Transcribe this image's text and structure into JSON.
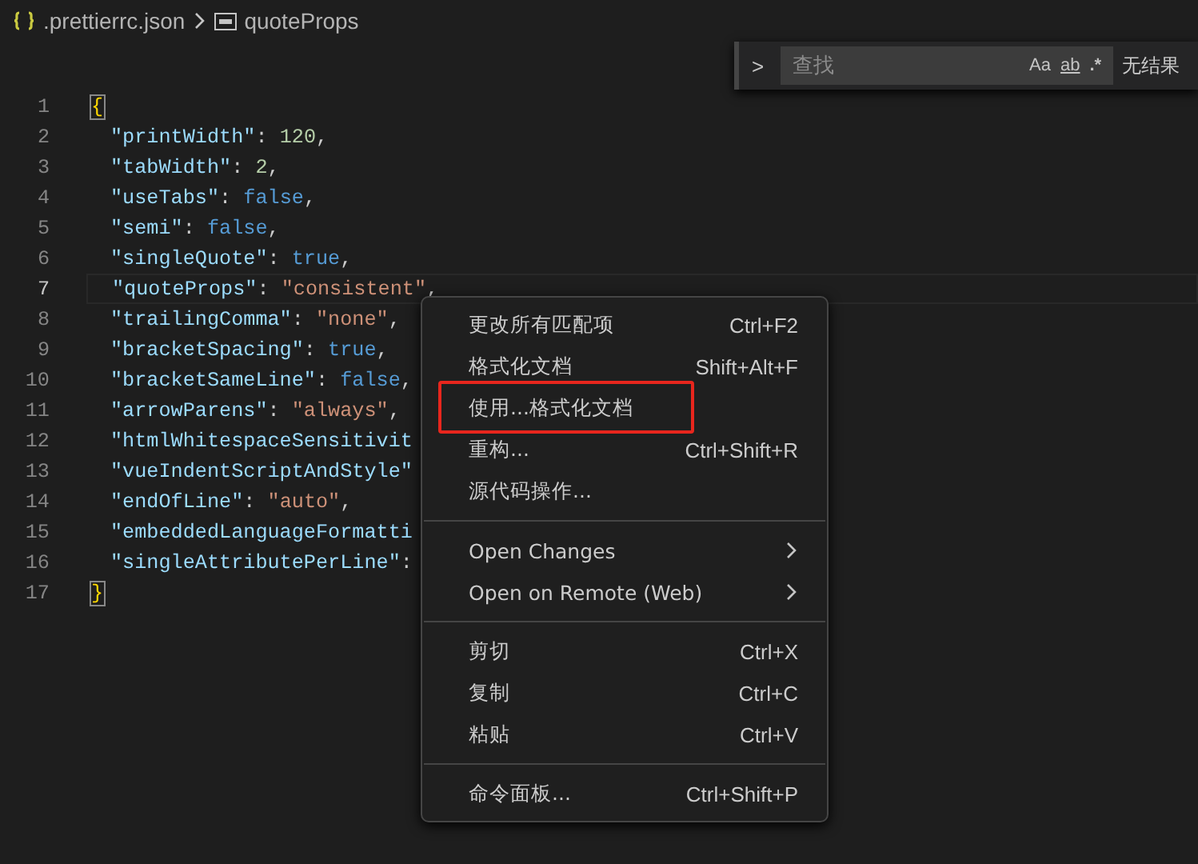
{
  "breadcrumb": [
    {
      "kind": "json",
      "label": ".prettierrc.json"
    },
    {
      "kind": "string",
      "label": "quoteProps"
    }
  ],
  "find_widget": {
    "toggle": ">",
    "placeholder": "查找",
    "options": [
      {
        "kind": "case",
        "label": "Aa"
      },
      {
        "kind": "word",
        "label": "ab"
      },
      {
        "kind": "regex",
        "label": ".*"
      }
    ],
    "result": "无结果"
  },
  "editor": {
    "lines": [
      {
        "number": "1",
        "current": false,
        "tokens": [
          {
            "kind": "brace",
            "text": "{",
            "matched": true
          }
        ]
      },
      {
        "number": "2",
        "current": false,
        "tokens": [
          {
            "kind": "key",
            "text": "\"printWidth\""
          },
          {
            "kind": "punct",
            "text": ": "
          },
          {
            "kind": "number",
            "text": "120"
          },
          {
            "kind": "punct",
            "text": ","
          }
        ]
      },
      {
        "number": "3",
        "current": false,
        "tokens": [
          {
            "kind": "key",
            "text": "\"tabWidth\""
          },
          {
            "kind": "punct",
            "text": ": "
          },
          {
            "kind": "number",
            "text": "2"
          },
          {
            "kind": "punct",
            "text": ","
          }
        ]
      },
      {
        "number": "4",
        "current": false,
        "tokens": [
          {
            "kind": "key",
            "text": "\"useTabs\""
          },
          {
            "kind": "punct",
            "text": ": "
          },
          {
            "kind": "bool",
            "text": "false"
          },
          {
            "kind": "punct",
            "text": ","
          }
        ]
      },
      {
        "number": "5",
        "current": false,
        "tokens": [
          {
            "kind": "key",
            "text": "\"semi\""
          },
          {
            "kind": "punct",
            "text": ": "
          },
          {
            "kind": "bool",
            "text": "false"
          },
          {
            "kind": "punct",
            "text": ","
          }
        ]
      },
      {
        "number": "6",
        "current": false,
        "tokens": [
          {
            "kind": "key",
            "text": "\"singleQuote\""
          },
          {
            "kind": "punct",
            "text": ": "
          },
          {
            "kind": "bool",
            "text": "true"
          },
          {
            "kind": "punct",
            "text": ","
          }
        ]
      },
      {
        "number": "7",
        "current": true,
        "tokens": [
          {
            "kind": "key",
            "text": "\"quoteProps\""
          },
          {
            "kind": "punct",
            "text": ": "
          },
          {
            "kind": "string",
            "text": "\"consistent\""
          },
          {
            "kind": "punct",
            "text": ","
          }
        ]
      },
      {
        "number": "8",
        "current": false,
        "tokens": [
          {
            "kind": "key",
            "text": "\"trailingComma\""
          },
          {
            "kind": "punct",
            "text": ": "
          },
          {
            "kind": "string",
            "text": "\"none\""
          },
          {
            "kind": "punct",
            "text": ","
          }
        ]
      },
      {
        "number": "9",
        "current": false,
        "tokens": [
          {
            "kind": "key",
            "text": "\"bracketSpacing\""
          },
          {
            "kind": "punct",
            "text": ": "
          },
          {
            "kind": "bool",
            "text": "true"
          },
          {
            "kind": "punct",
            "text": ","
          }
        ]
      },
      {
        "number": "10",
        "current": false,
        "tokens": [
          {
            "kind": "key",
            "text": "\"bracketSameLine\""
          },
          {
            "kind": "punct",
            "text": ": "
          },
          {
            "kind": "bool",
            "text": "false"
          },
          {
            "kind": "punct",
            "text": ","
          }
        ]
      },
      {
        "number": "11",
        "current": false,
        "tokens": [
          {
            "kind": "key",
            "text": "\"arrowParens\""
          },
          {
            "kind": "punct",
            "text": ": "
          },
          {
            "kind": "string",
            "text": "\"always\""
          },
          {
            "kind": "punct",
            "text": ","
          }
        ]
      },
      {
        "number": "12",
        "current": false,
        "tokens": [
          {
            "kind": "key",
            "text": "\"htmlWhitespaceSensitivit"
          }
        ]
      },
      {
        "number": "13",
        "current": false,
        "tokens": [
          {
            "kind": "key",
            "text": "\"vueIndentScriptAndStyle\""
          }
        ]
      },
      {
        "number": "14",
        "current": false,
        "tokens": [
          {
            "kind": "key",
            "text": "\"endOfLine\""
          },
          {
            "kind": "punct",
            "text": ": "
          },
          {
            "kind": "string",
            "text": "\"auto\""
          },
          {
            "kind": "punct",
            "text": ","
          }
        ]
      },
      {
        "number": "15",
        "current": false,
        "tokens": [
          {
            "kind": "key",
            "text": "\"embeddedLanguageFormatti"
          }
        ]
      },
      {
        "number": "16",
        "current": false,
        "tokens": [
          {
            "kind": "key",
            "text": "\"singleAttributePerLine\""
          },
          {
            "kind": "punct",
            "text": ":"
          }
        ]
      },
      {
        "number": "17",
        "current": false,
        "tokens": [
          {
            "kind": "brace",
            "text": "}",
            "matched": true
          }
        ]
      }
    ]
  },
  "context_menu": {
    "groups": [
      [
        {
          "label": "更改所有匹配项",
          "shortcut": "Ctrl+F2",
          "submenu": false,
          "highlighted": false
        },
        {
          "label": "格式化文档",
          "shortcut": "Shift+Alt+F",
          "submenu": false,
          "highlighted": false
        },
        {
          "label": "使用...格式化文档",
          "submenu": false,
          "highlighted": true
        },
        {
          "label": "重构...",
          "shortcut": "Ctrl+Shift+R",
          "submenu": false,
          "highlighted": false
        },
        {
          "label": "源代码操作...",
          "submenu": false,
          "highlighted": false
        }
      ],
      [
        {
          "label": "Open Changes",
          "submenu": true,
          "highlighted": false
        },
        {
          "label": "Open on Remote (Web)",
          "submenu": true,
          "highlighted": false
        }
      ],
      [
        {
          "label": "剪切",
          "shortcut": "Ctrl+X",
          "submenu": false,
          "highlighted": false
        },
        {
          "label": "复制",
          "shortcut": "Ctrl+C",
          "submenu": false,
          "highlighted": false
        },
        {
          "label": "粘贴",
          "shortcut": "Ctrl+V",
          "submenu": false,
          "highlighted": false
        }
      ],
      [
        {
          "label": "命令面板...",
          "shortcut": "Ctrl+Shift+P",
          "submenu": false,
          "highlighted": false
        }
      ]
    ]
  }
}
